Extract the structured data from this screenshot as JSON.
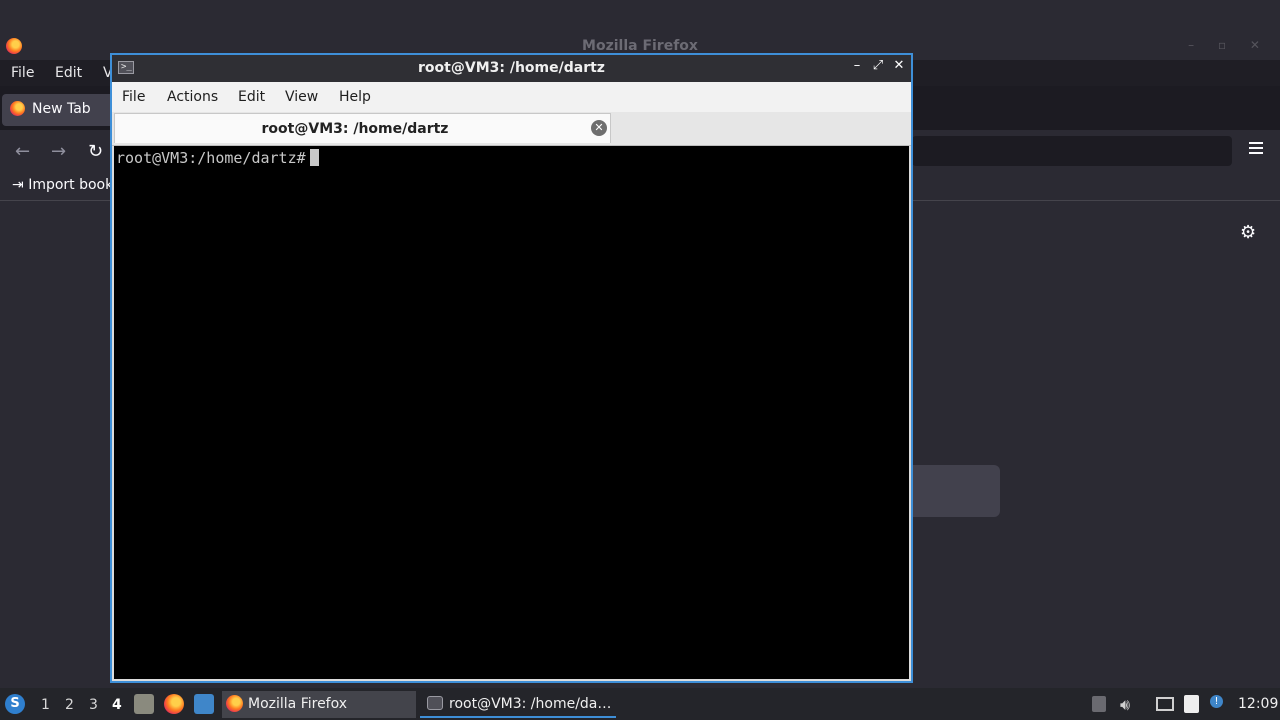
{
  "firefox": {
    "window_title": "Mozilla Firefox",
    "menu": {
      "file": "File",
      "edit": "Edit",
      "view_partial": "V"
    },
    "tab_label": "New Tab",
    "bookmark_label": "Import book",
    "icons": [
      "firefox-logo",
      "back-arrow",
      "forward-arrow",
      "reload",
      "hamburger-menu",
      "import-bookmarks",
      "gear"
    ]
  },
  "terminal": {
    "title": "root@VM3: /home/dartz",
    "menu": [
      "File",
      "Actions",
      "Edit",
      "View",
      "Help"
    ],
    "tab_label": "root@VM3: /home/dartz",
    "prompt": "root@VM3:/home/dartz#",
    "colors": {
      "border": "#3e8fd8",
      "titlebar": "#2f2f34",
      "screen": "#000000",
      "text": "#c8c8c8"
    }
  },
  "taskbar": {
    "workspaces": [
      "1",
      "2",
      "3",
      "4"
    ],
    "active_workspace": "4",
    "tasks": [
      {
        "label": "Mozilla Firefox",
        "icon": "firefox-logo"
      },
      {
        "label": "root@VM3: /home/da…",
        "icon": "terminal-icon"
      }
    ],
    "clock": "12:09",
    "tray_icons": [
      "tray-up-arrow",
      "volume-icon",
      "network-icon",
      "clipboard-icon",
      "notification-icon"
    ]
  }
}
